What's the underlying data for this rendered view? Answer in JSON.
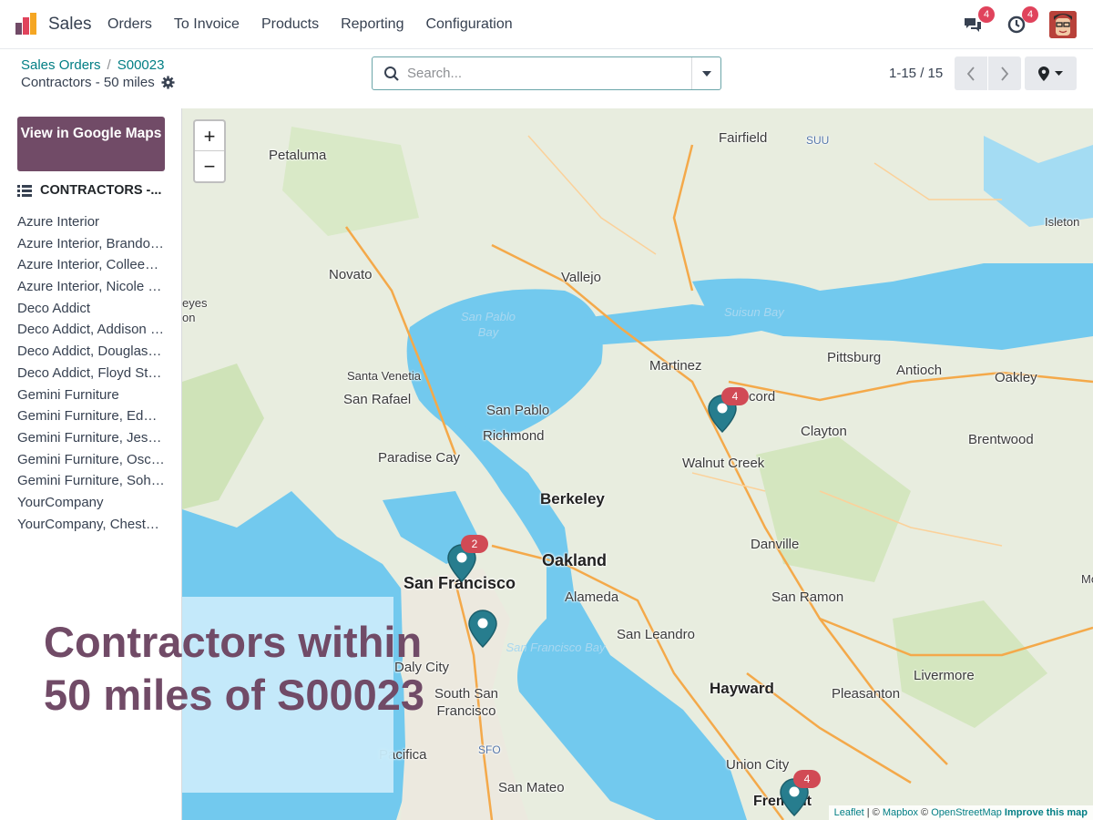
{
  "app": {
    "name": "Sales"
  },
  "menu": [
    "Orders",
    "To Invoice",
    "Products",
    "Reporting",
    "Configuration"
  ],
  "systray": {
    "messages_count": "4",
    "activities_count": "4",
    "avatar_icon": "user-avatar"
  },
  "breadcrumb": {
    "parent": "Sales Orders",
    "separator": "/",
    "current": "S00023"
  },
  "view_title": "Contractors - 50 miles",
  "search": {
    "placeholder": "Search...",
    "value": ""
  },
  "pager": {
    "value": "1-15 / 15"
  },
  "sidebar": {
    "google_maps_button": "View in Google Maps",
    "list_header": "CONTRACTORS -...",
    "records": [
      "Azure Interior",
      "Azure Interior, Brandon Freeman",
      "Azure Interior, Colleen Diaz",
      "Azure Interior, Nicole Ford",
      "Deco Addict",
      "Deco Addict, Addison Olson",
      "Deco Addict, Douglas Fletcher",
      "Deco Addict, Floyd Steward",
      "Gemini Furniture",
      "Gemini Furniture, Edwin Hansen",
      "Gemini Furniture, Jesse Brown",
      "Gemini Furniture, Oscar Morgan",
      "Gemini Furniture, Soham Palmer",
      "YourCompany",
      "YourCompany, Chester Reed"
    ]
  },
  "map": {
    "zoom_in": "+",
    "zoom_out": "−",
    "places": {
      "fairfield": "Fairfield",
      "suu": "SUU",
      "petaluma": "Petaluma",
      "isleton": "Isleton",
      "novato": "Novato",
      "vallejo": "Vallejo",
      "eyes": "eyes",
      "on": "on",
      "san_pablo_bay": "San Pablo Bay",
      "suisun_bay": "Suisun Bay",
      "martinez": "Martinez",
      "pittsburg": "Pittsburg",
      "antioch": "Antioch",
      "oakley": "Oakley",
      "santa_venetia": "Santa Venetia",
      "san_rafael": "San Rafael",
      "cord": "cord",
      "san_pablo": "San Pablo",
      "clayton": "Clayton",
      "richmond": "Richmond",
      "brentwood": "Brentwood",
      "paradise_cay": "Paradise Cay",
      "walnut_creek": "Walnut Creek",
      "berkeley": "Berkeley",
      "danville": "Danville",
      "oakland": "Oakland",
      "san_francisco": "San Francisco",
      "alameda": "Alameda",
      "san_ramon": "San Ramon",
      "san_leandro": "San Leandro",
      "mou": "Mou",
      "san_francisco_bay": "San Francisco Bay",
      "daly_city": "Daly City",
      "hayward": "Hayward",
      "livermore": "Livermore",
      "south_san_francisco": "South San Francisco",
      "pleasanton": "Pleasanton",
      "sfo": "SFO",
      "pacifica": "Pacifica",
      "union_city": "Union City",
      "san_mateo": "San Mateo",
      "fremont": "Fremont"
    },
    "markers": [
      {
        "count": "4"
      },
      {
        "count": "2"
      },
      {
        "count": ""
      },
      {
        "count": "4"
      }
    ],
    "attribution": {
      "leaflet": "Leaflet",
      "sep1": "| ©",
      "mapbox": "Mapbox",
      "sep2": "©",
      "osm": "OpenStreetMap",
      "improve": "Improve this map"
    }
  },
  "caption": "Contractors within 50 miles of S00023"
}
